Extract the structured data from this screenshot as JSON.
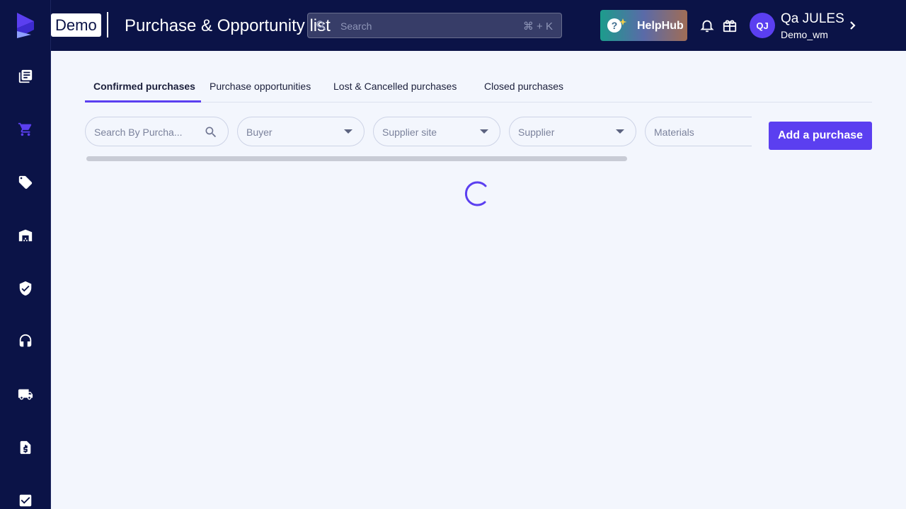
{
  "app": {
    "brand_color": "#5b3ff0",
    "nav_bg": "#0b1347",
    "workspace_badge": "Demo",
    "page_title": "Purchase & Opportunity list"
  },
  "sidebar": {
    "items": [
      {
        "icon": "catalog-icon"
      },
      {
        "icon": "cart-icon",
        "active": true
      },
      {
        "icon": "tag-icon"
      },
      {
        "icon": "warehouse-icon"
      },
      {
        "icon": "shield-check-icon"
      },
      {
        "icon": "headset-icon"
      },
      {
        "icon": "truck-icon"
      },
      {
        "icon": "invoice-icon"
      },
      {
        "icon": "checkbox-icon"
      }
    ]
  },
  "header": {
    "search_placeholder": "Search",
    "search_shortcut": "⌘ + K",
    "helphub_label": "HelpHub",
    "user_initials": "QJ",
    "user_name": "Qa JULES",
    "user_org": "Demo_wm"
  },
  "tabs": [
    {
      "label": "Confirmed purchases",
      "active": true
    },
    {
      "label": "Purchase opportunities"
    },
    {
      "label": "Lost & Cancelled purchases"
    },
    {
      "label": "Closed purchases"
    }
  ],
  "filters": {
    "search_placeholder": "Search By Purcha...",
    "buyer": "Buyer",
    "supplier_site": "Supplier site",
    "supplier": "Supplier",
    "materials": "Materials"
  },
  "actions": {
    "add_purchase": "Add a purchase"
  },
  "status": {
    "loading": true
  }
}
